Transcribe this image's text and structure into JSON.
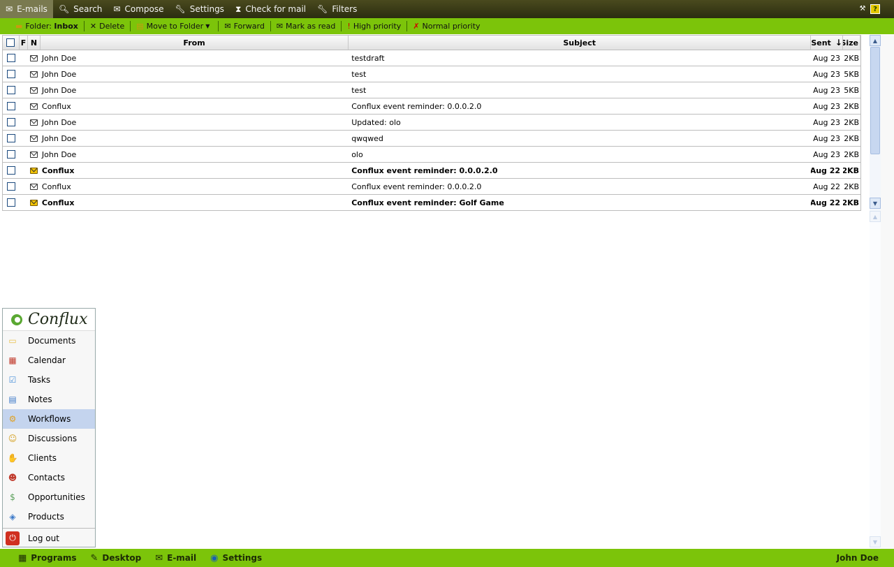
{
  "nav": {
    "items": [
      {
        "label": "E-mails",
        "icon": "envelope-icon",
        "active": true
      },
      {
        "label": "Search",
        "icon": "search-icon"
      },
      {
        "label": "Compose",
        "icon": "compose-icon"
      },
      {
        "label": "Settings",
        "icon": "wrench-icon"
      },
      {
        "label": "Check for mail",
        "icon": "hourglass-icon"
      },
      {
        "label": "Filters",
        "icon": "wrench-icon"
      }
    ],
    "help_label": "?"
  },
  "toolbar": {
    "folder_label": "Folder:",
    "folder_value": "Inbox",
    "delete": "Delete",
    "move": "Move to Folder",
    "forward": "Forward",
    "mark_read": "Mark as read",
    "high_priority": "High priority",
    "normal_priority": "Normal priority"
  },
  "table": {
    "headers": {
      "f": "F",
      "n": "N",
      "from": "From",
      "subject": "Subject",
      "sent": "Sent",
      "size": "Size"
    },
    "rows": [
      {
        "from": "John Doe",
        "subject": "testdraft",
        "sent": "Aug 23",
        "size": "2KB",
        "unread": false
      },
      {
        "from": "John Doe",
        "subject": "test",
        "sent": "Aug 23",
        "size": "5KB",
        "unread": false
      },
      {
        "from": "John Doe",
        "subject": "test",
        "sent": "Aug 23",
        "size": "5KB",
        "unread": false
      },
      {
        "from": "Conflux",
        "subject": "Conflux event reminder: 0.0.0.2.0",
        "sent": "Aug 23",
        "size": "2KB",
        "unread": false
      },
      {
        "from": "John Doe",
        "subject": "Updated: olo",
        "sent": "Aug 23",
        "size": "2KB",
        "unread": false
      },
      {
        "from": "John Doe",
        "subject": "qwqwed",
        "sent": "Aug 23",
        "size": "2KB",
        "unread": false
      },
      {
        "from": "John Doe",
        "subject": "olo",
        "sent": "Aug 23",
        "size": "2KB",
        "unread": false
      },
      {
        "from": "Conflux",
        "subject": "Conflux event reminder: 0.0.0.2.0",
        "sent": "Aug 22",
        "size": "2KB",
        "unread": true
      },
      {
        "from": "Conflux",
        "subject": "Conflux event reminder: 0.0.0.2.0",
        "sent": "Aug 22",
        "size": "2KB",
        "unread": false
      },
      {
        "from": "Conflux",
        "subject": "Conflux event reminder: Golf Game",
        "sent": "Aug 22",
        "size": "2KB",
        "unread": true
      }
    ]
  },
  "menu": {
    "logo": "Conflux",
    "items": [
      {
        "label": "Documents",
        "icon": "folder-icon",
        "color": "#e9c04a"
      },
      {
        "label": "Calendar",
        "icon": "calendar-icon",
        "color": "#c0392b"
      },
      {
        "label": "Tasks",
        "icon": "tasks-icon",
        "color": "#4a90d9"
      },
      {
        "label": "Notes",
        "icon": "notes-icon",
        "color": "#3a78c8"
      },
      {
        "label": "Workflows",
        "icon": "gears-icon",
        "color": "#e0a020",
        "active": true
      },
      {
        "label": "Discussions",
        "icon": "people-icon",
        "color": "#d4a020"
      },
      {
        "label": "Clients",
        "icon": "handshake-icon",
        "color": "#b87a4a"
      },
      {
        "label": "Contacts",
        "icon": "contacts-icon",
        "color": "#c0392b"
      },
      {
        "label": "Opportunities",
        "icon": "money-icon",
        "color": "#5aa05a"
      },
      {
        "label": "Products",
        "icon": "products-icon",
        "color": "#3a78c8"
      }
    ],
    "logout": "Log out"
  },
  "bottom": {
    "items": [
      {
        "label": "Programs",
        "icon": "programs-icon"
      },
      {
        "label": "Desktop",
        "icon": "desktop-icon"
      },
      {
        "label": "E-mail",
        "icon": "email-icon"
      },
      {
        "label": "Settings",
        "icon": "globe-icon"
      }
    ],
    "user": "John Doe"
  }
}
